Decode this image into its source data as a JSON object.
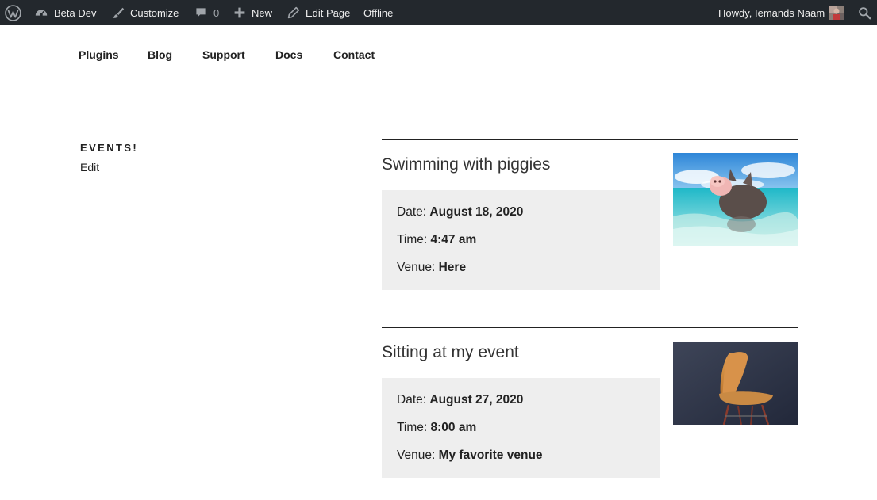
{
  "admin_bar": {
    "site_name": "Beta Dev",
    "customize": "Customize",
    "comments_count": "0",
    "new": "New",
    "edit_page": "Edit Page",
    "offline": "Offline",
    "howdy": "Howdy, Iemands Naam"
  },
  "nav": {
    "items": [
      "Plugins",
      "Blog",
      "Support",
      "Docs",
      "Contact"
    ]
  },
  "sidebar": {
    "title": "EVENTS!",
    "edit": "Edit"
  },
  "events": [
    {
      "title": "Swimming with piggies",
      "date_label": "Date:",
      "date": "August 18, 2020",
      "time_label": "Time:",
      "time": "4:47 am",
      "venue_label": "Venue:",
      "venue": "Here"
    },
    {
      "title": "Sitting at my event",
      "date_label": "Date:",
      "date": "August 27, 2020",
      "time_label": "Time:",
      "time": "8:00 am",
      "venue_label": "Venue:",
      "venue": "My favorite venue"
    }
  ]
}
